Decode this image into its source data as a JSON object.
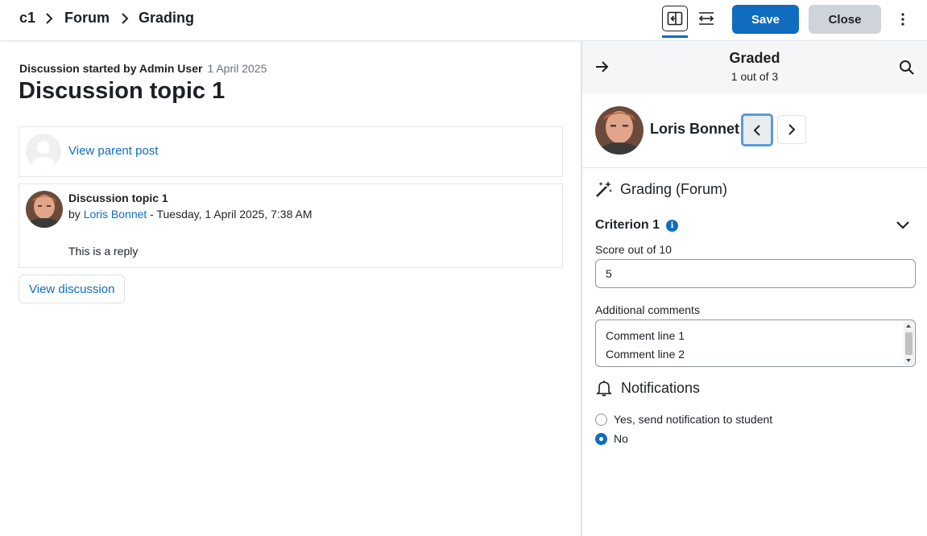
{
  "breadcrumb": [
    "c1",
    "Forum",
    "Grading"
  ],
  "header": {
    "save_label": "Save",
    "close_label": "Close"
  },
  "discussion": {
    "started_prefix": "Discussion started by Admin User",
    "started_date": "1 April 2025",
    "title": "Discussion topic 1",
    "parent_link": "View parent post",
    "post": {
      "subject": "Discussion topic 1",
      "by": "by",
      "author": "Loris Bonnet",
      "date": " - Tuesday, 1 April 2025, 7:38 AM",
      "body": "This is a reply"
    },
    "view_discussion": "View discussion"
  },
  "panel": {
    "status_title": "Graded",
    "status_sub": "1 out of 3",
    "user_name": "Loris Bonnet",
    "grading_title": "Grading (Forum)",
    "criterion": "Criterion 1",
    "info_glyph": "i",
    "score_label": "Score out of 10",
    "score_value": "5",
    "comments_label": "Additional comments",
    "comment_lines": [
      "Comment line 1",
      "Comment line 2"
    ],
    "notifications_title": "Notifications",
    "radio_yes": "Yes, send notification to student",
    "radio_no": "No",
    "selected_option": "No"
  },
  "colors": {
    "primary": "#0f6cbf",
    "secondary_btn": "#ced4da",
    "focus_ring": "#5b9ad6"
  },
  "icons": [
    "chevron-right-icon",
    "collapse-panel-icon",
    "expand-horizontal-icon",
    "kebab-menu-icon",
    "arrow-right-icon",
    "search-icon",
    "chevron-left-icon",
    "magic-wand-icon",
    "info-icon",
    "chevron-down-icon",
    "bell-icon"
  ]
}
